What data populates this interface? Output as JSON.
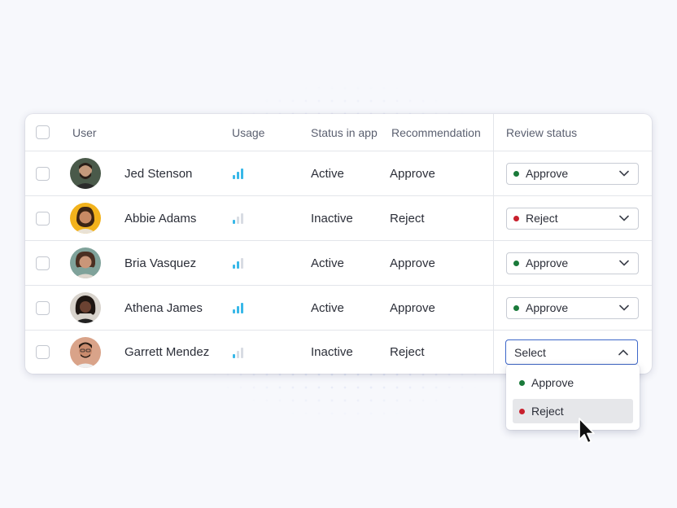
{
  "colors": {
    "accent": "#3d67c9",
    "approve_dot": "#1a7a3a",
    "reject_dot": "#c8202d",
    "usage_bar_active": "#38b8e8",
    "usage_bar_inactive": "#d8dce3"
  },
  "table": {
    "headers": {
      "user": "User",
      "usage": "Usage",
      "status": "Status in app",
      "recommendation": "Recommendation",
      "review": "Review status"
    },
    "rows": [
      {
        "name": "Jed Stenson",
        "usage_level": 3,
        "status": "Active",
        "recommendation": "Approve",
        "review": "Approve",
        "review_state": "approve"
      },
      {
        "name": "Abbie Adams",
        "usage_level": 1,
        "status": "Inactive",
        "recommendation": "Reject",
        "review": "Reject",
        "review_state": "reject"
      },
      {
        "name": "Bria Vasquez",
        "usage_level": 2,
        "status": "Active",
        "recommendation": "Approve",
        "review": "Approve",
        "review_state": "approve"
      },
      {
        "name": "Athena James",
        "usage_level": 3,
        "status": "Active",
        "recommendation": "Approve",
        "review": "Approve",
        "review_state": "approve"
      },
      {
        "name": "Garrett Mendez",
        "usage_level": 1,
        "status": "Inactive",
        "recommendation": "Reject",
        "review": "Select",
        "review_state": "open"
      }
    ]
  },
  "dropdown": {
    "options": [
      {
        "label": "Approve",
        "state": "approve"
      },
      {
        "label": "Reject",
        "state": "reject",
        "highlighted": true
      }
    ]
  },
  "icons": {
    "chevron_down": "chevron-down-icon",
    "chevron_up": "chevron-up-icon",
    "cursor": "mouse-pointer-icon",
    "usage": "signal-bars-icon"
  }
}
